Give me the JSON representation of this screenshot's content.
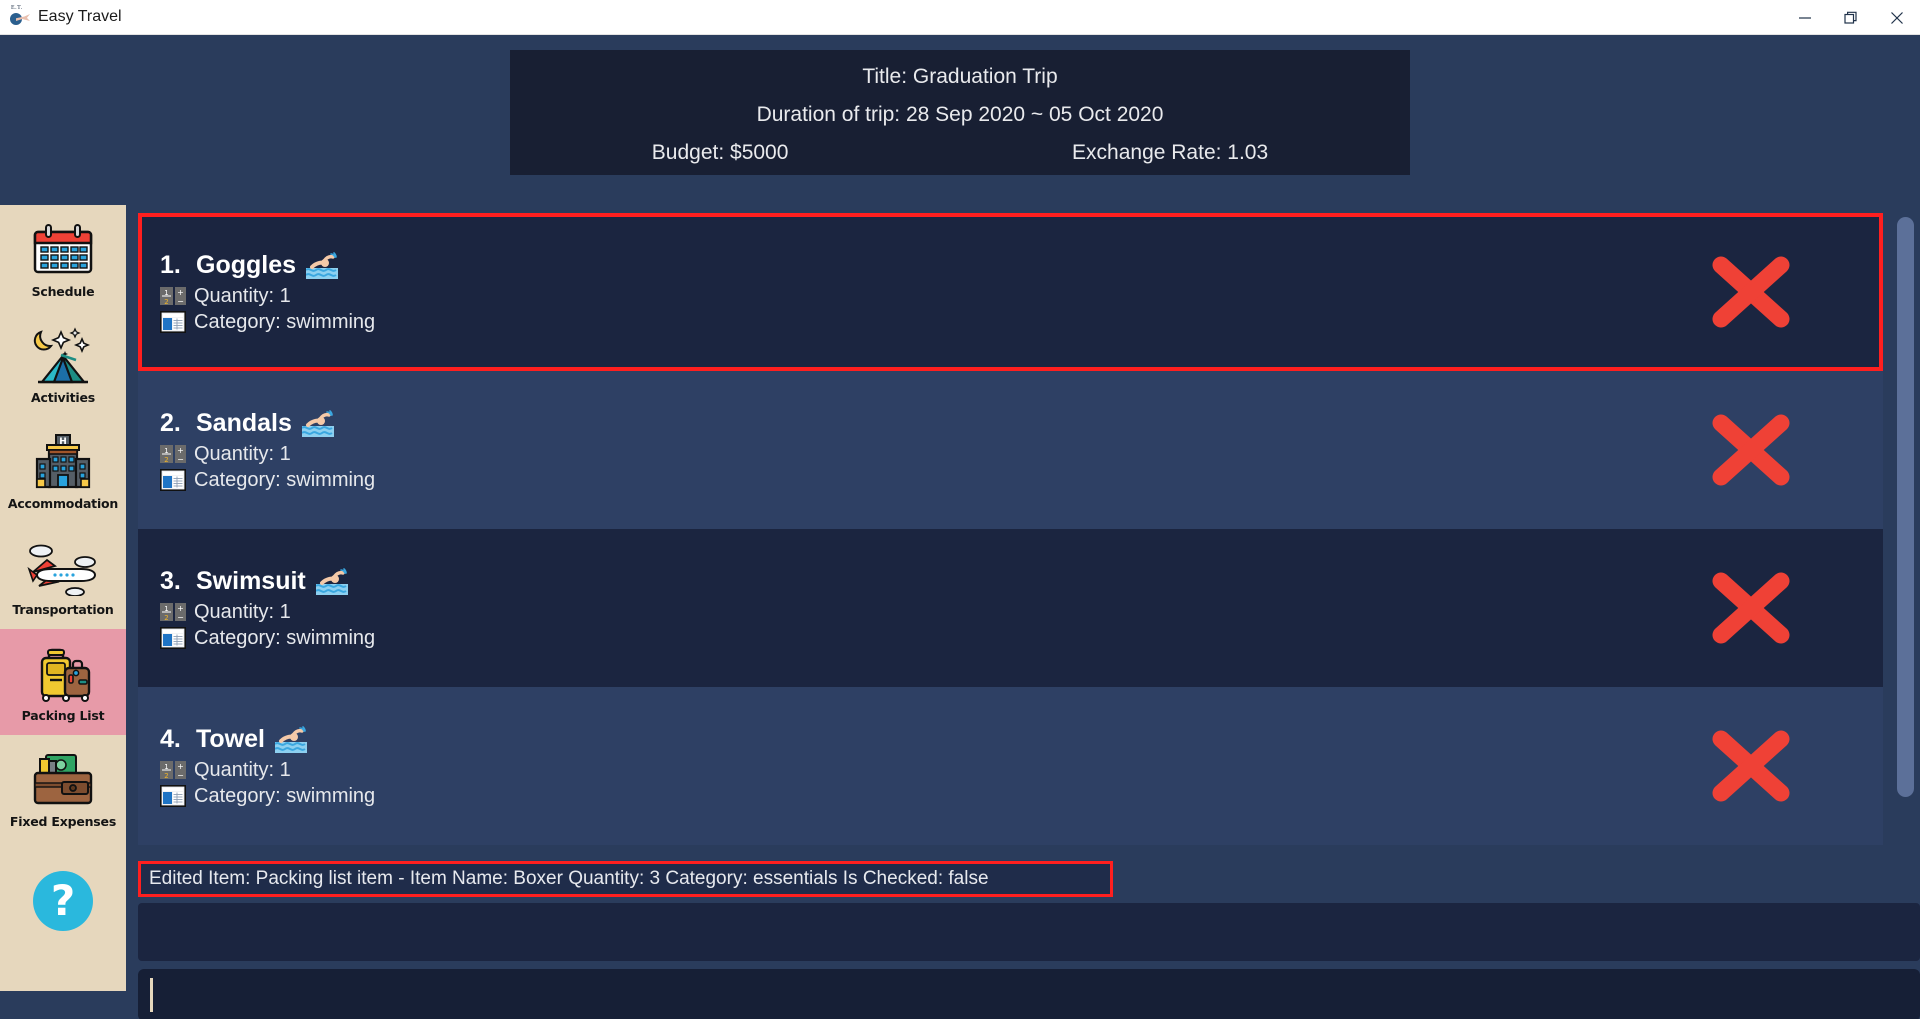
{
  "window": {
    "title": "Easy Travel",
    "app_icon": "globe-plane-icon",
    "controls": {
      "minimize": "minimize-icon",
      "maximize": "restore-icon",
      "close": "close-icon"
    }
  },
  "trip_header": {
    "title_line": "Title: Graduation Trip",
    "duration_line": "Duration of trip: 28 Sep 2020 ~ 05 Oct 2020",
    "budget_line": "Budget: $5000",
    "exchange_rate_line": "Exchange Rate: 1.03"
  },
  "sidebar": {
    "items": [
      {
        "label": "Schedule",
        "icon": "calendar-icon",
        "active": false
      },
      {
        "label": "Activities",
        "icon": "tent-night-icon",
        "active": false
      },
      {
        "label": "Accommodation",
        "icon": "hotel-icon",
        "active": false
      },
      {
        "label": "Transportation",
        "icon": "airplane-icon",
        "active": false
      },
      {
        "label": "Packing List",
        "icon": "luggage-icon",
        "active": true
      },
      {
        "label": "Fixed Expenses",
        "icon": "wallet-icon",
        "active": false
      }
    ],
    "help": {
      "label": "",
      "icon": "question-mark-icon"
    }
  },
  "packing_list": {
    "quantity_icon": "number-spinner-icon",
    "category_icon": "form-table-icon",
    "item_emoji": "swimmer-icon",
    "delete_icon": "red-cross-delete-icon",
    "items": [
      {
        "index": "1.",
        "name": "Goggles",
        "quantity": "Quantity: 1",
        "category": "Category: swimming",
        "selected": true
      },
      {
        "index": "2.",
        "name": "Sandals",
        "quantity": "Quantity: 1",
        "category": "Category: swimming",
        "selected": false
      },
      {
        "index": "3.",
        "name": "Swimsuit",
        "quantity": "Quantity: 1",
        "category": "Category: swimming",
        "selected": false
      },
      {
        "index": "4.",
        "name": "Towel",
        "quantity": "Quantity: 1",
        "category": "Category: swimming",
        "selected": false
      }
    ]
  },
  "status_bar": {
    "text": "Edited Item: Packing list item - Item Name: Boxer Quantity: 3 Category: essentials Is Checked: false",
    "highlight_color": "#ff1f1f"
  },
  "input": {
    "value": "",
    "placeholder": ""
  },
  "colors": {
    "app_background": "#2a3c5c",
    "row_dark": "#1b2540",
    "row_light": "#2e4064",
    "header_card": "#181f33",
    "sidebar_background": "#e6d7bd",
    "sidebar_active": "#e79aa8",
    "delete_red": "#ef4136",
    "accent_highlight": "#ff1f1f"
  }
}
